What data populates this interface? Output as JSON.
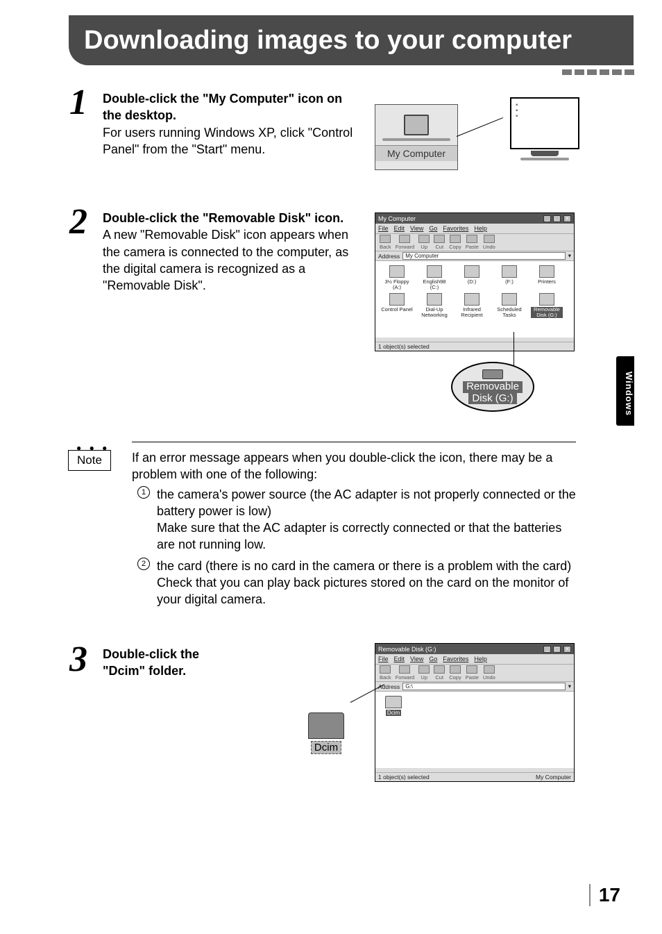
{
  "heading": "Downloading images to your computer",
  "sideTab": "Windows",
  "pageNumber": "17",
  "steps": {
    "s1": {
      "num": "1",
      "bold": "Double-click the \"My Computer\" icon on the desktop.",
      "body": "For users running Windows XP, click \"Control Panel\" from the \"Start\" menu."
    },
    "s2": {
      "num": "2",
      "bold": "Double-click the \"Removable Disk\" icon.",
      "body": "A new \"Removable Disk\" icon appears when the camera is connected to the computer, as the digital camera is recognized as a \"Removable Disk\"."
    },
    "s3": {
      "num": "3",
      "bold1": "Double-click the",
      "bold2": "\"Dcim\" folder."
    }
  },
  "note": {
    "label": "Note",
    "intro": "If an error message appears when you double-click the icon, there may be a problem with one of the following:",
    "items": {
      "i1n": "1",
      "i1a": "the camera's power source (the AC adapter is not properly connected or the battery power is low)",
      "i1b": "Make sure that the AC adapter is correctly connected or that the batteries are not running low.",
      "i2n": "2",
      "i2a": "the card (there is no card in the camera or there is a problem with the card)",
      "i2b": "Check that you can play back pictures stored on the card on the monitor of your digital camera."
    }
  },
  "illus": {
    "myComputerLabel": "My Computer",
    "calloutLine1": "Removable",
    "calloutLine2": "Disk (G:)",
    "dcimLabel": "Dcim",
    "win1": {
      "title": "My Computer",
      "menu": {
        "file": "File",
        "edit": "Edit",
        "view": "View",
        "go": "Go",
        "fav": "Favorites",
        "help": "Help"
      },
      "tb": {
        "back": "Back",
        "forward": "Forward",
        "up": "Up",
        "cut": "Cut",
        "copy": "Copy",
        "paste": "Paste",
        "undo": "Undo"
      },
      "addrLabel": "Address",
      "addrField": "My Computer",
      "icons": {
        "floppy": "3½ Floppy (A:)",
        "c": "English98 (C:)",
        "d": "(D:)",
        "f": "(F:)",
        "printers": "Printers",
        "cp": "Control Panel",
        "dun": "Dial-Up Networking",
        "ir": "Infrared Recipient",
        "st": "Scheduled Tasks",
        "rem": "Removable Disk (G:)"
      },
      "status": "1 object(s) selected"
    },
    "win2": {
      "title": "Removable Disk (G:)",
      "addrField": "G:\\",
      "statusL": "1 object(s) selected",
      "statusR": "My Computer"
    }
  }
}
